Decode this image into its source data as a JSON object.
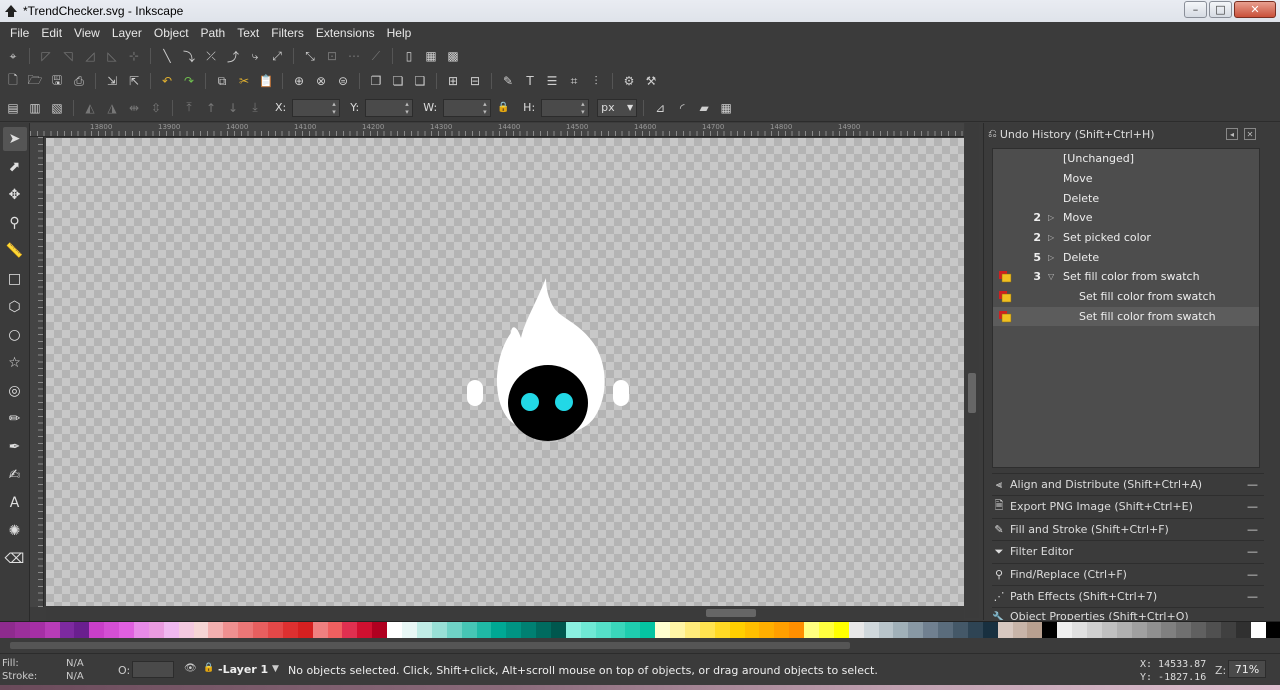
{
  "window": {
    "title": "*TrendChecker.svg - Inkscape",
    "minimize": "–",
    "maximize": "□",
    "close": "✕"
  },
  "menu": [
    "File",
    "Edit",
    "View",
    "Layer",
    "Object",
    "Path",
    "Text",
    "Filters",
    "Extensions",
    "Help"
  ],
  "controls": {
    "x_label": "X:",
    "y_label": "Y:",
    "w_label": "W:",
    "h_label": "H:",
    "unit": "px"
  },
  "ruler": {
    "labels": [
      "13800",
      "13900",
      "14000",
      "14100",
      "14200",
      "14300",
      "14400",
      "14500",
      "14600",
      "14700",
      "14800",
      "14900"
    ]
  },
  "undo_history": {
    "title": "Undo History (Shift+Ctrl+H)",
    "rows": [
      {
        "label": "[Unchanged]",
        "count": "",
        "arrow": "",
        "icon": false,
        "indent": 0
      },
      {
        "label": "Move",
        "count": "",
        "arrow": "",
        "icon": false,
        "indent": 0
      },
      {
        "label": "Delete",
        "count": "",
        "arrow": "",
        "icon": false,
        "indent": 0
      },
      {
        "label": "Move",
        "count": "2",
        "arrow": "▷",
        "icon": false,
        "indent": 0
      },
      {
        "label": "Set picked color",
        "count": "2",
        "arrow": "▷",
        "icon": false,
        "indent": 0
      },
      {
        "label": "Delete",
        "count": "5",
        "arrow": "▷",
        "icon": false,
        "indent": 0
      },
      {
        "label": "Set fill color from swatch",
        "count": "3",
        "arrow": "▽",
        "icon": true,
        "indent": 0
      },
      {
        "label": "Set fill color from swatch",
        "count": "",
        "arrow": "",
        "icon": true,
        "indent": 1
      },
      {
        "label": "Set fill color from swatch",
        "count": "",
        "arrow": "",
        "icon": true,
        "indent": 1,
        "selected": true
      }
    ]
  },
  "dock_panels": [
    {
      "label": "Align and Distribute (Shift+Ctrl+A)",
      "icon": "align-icon"
    },
    {
      "label": "Export PNG Image (Shift+Ctrl+E)",
      "icon": "export-icon"
    },
    {
      "label": "Fill and Stroke (Shift+Ctrl+F)",
      "icon": "fill-stroke-icon"
    },
    {
      "label": "Filter Editor",
      "icon": "filter-icon"
    },
    {
      "label": "Find/Replace (Ctrl+F)",
      "icon": "find-icon"
    },
    {
      "label": "Path Effects  (Shift+Ctrl+7)",
      "icon": "path-effects-icon"
    },
    {
      "label": "Object Properties (Shift+Ctrl+O)",
      "icon": "object-properties-icon"
    }
  ],
  "status": {
    "fill_label": "Fill:",
    "fill_value": "N/A",
    "stroke_label": "Stroke:",
    "stroke_value": "N/A",
    "opacity_label": "O:",
    "layer": "-Layer 1",
    "message": "No objects selected. Click, Shift+click, Alt+scroll mouse on top of objects, or drag around objects to select.",
    "x_coord": "X: 14533.87",
    "y_coord": "Y: -1827.16",
    "zoom_label": "Z:",
    "zoom": "71%"
  },
  "palette_colors": [
    "#8e2b8e",
    "#9b2f9b",
    "#a52fa5",
    "#b73cb7",
    "#7d2aa0",
    "#6a1f8f",
    "#c93fc9",
    "#d44fd4",
    "#e060e0",
    "#e88be8",
    "#ea9be0",
    "#f0b8f0",
    "#f4c9e0",
    "#f6d5d5",
    "#f3b0b0",
    "#ef9090",
    "#ec7777",
    "#e85f5f",
    "#e34848",
    "#de3030",
    "#d62020",
    "#f08080",
    "#f06060",
    "#e03050",
    "#d01030",
    "#b00020",
    "#ffffff",
    "#e8f7f5",
    "#c0ece6",
    "#98e0d6",
    "#6fd3c6",
    "#46c6b5",
    "#1fb9a5",
    "#00a894",
    "#009483",
    "#008072",
    "#006b5f",
    "#00574e",
    "#8af0e0",
    "#6fe8d4",
    "#55dfc8",
    "#3ad6bb",
    "#1fcdaf",
    "#05c4a2",
    "#ffffd0",
    "#fff6a6",
    "#ffec7b",
    "#ffe350",
    "#ffd925",
    "#ffcf00",
    "#ffbf00",
    "#ffaf00",
    "#ff9f00",
    "#ff8f00",
    "#ffff80",
    "#ffff40",
    "#ffff00",
    "#e8e8e8",
    "#d0d8dc",
    "#b8c4ca",
    "#a0b0b8",
    "#8898a4",
    "#708090",
    "#5a6c7c",
    "#445868",
    "#2e4454",
    "#183040",
    "#d8c8c0",
    "#c8b4a8",
    "#b8a090",
    "#000000",
    "#f0f0f0",
    "#e0e0e0",
    "#d0d0d0",
    "#c0c0c0",
    "#b0b0b0",
    "#a0a0a0",
    "#909090",
    "#808080",
    "#707070",
    "#606060",
    "#505050",
    "#404040",
    "#303030",
    "#ffffff",
    "#000000"
  ]
}
